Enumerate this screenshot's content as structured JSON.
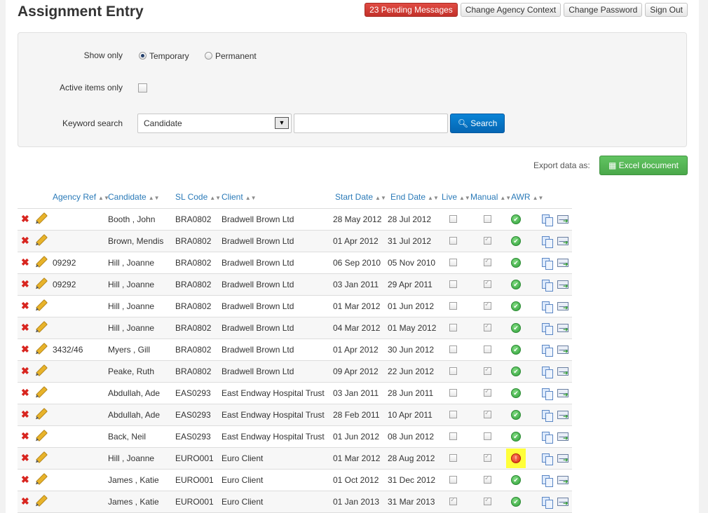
{
  "page": {
    "title": "Assignment Entry"
  },
  "topbar": {
    "pending": "23 Pending Messages",
    "change_agency": "Change Agency Context",
    "change_password": "Change Password",
    "sign_out": "Sign Out"
  },
  "filters": {
    "show_only_label": "Show only",
    "option_temporary": "Temporary",
    "option_permanent": "Permanent",
    "selected": "Temporary",
    "active_only_label": "Active items only",
    "active_only_checked": false,
    "keyword_label": "Keyword search",
    "keyword_field": "Candidate",
    "keyword_value": "",
    "search_label": "Search"
  },
  "export": {
    "label": "Export data as:",
    "excel_label": "Excel document"
  },
  "table": {
    "columns": [
      "Agency Ref",
      "Candidate",
      "SL Code",
      "Client",
      "Start Date",
      "End Date",
      "Live",
      "Manual",
      "AWR"
    ],
    "rows": [
      {
        "ref": "",
        "candidate": "Booth , John",
        "sl": "BRA0802",
        "client": "Bradwell Brown Ltd",
        "start": "28 May 2012",
        "end": "28 Jul 2012",
        "live": false,
        "manual": false,
        "awr": "ok"
      },
      {
        "ref": "",
        "candidate": "Brown, Mendis",
        "sl": "BRA0802",
        "client": "Bradwell Brown Ltd",
        "start": "01 Apr 2012",
        "end": "31 Jul 2012",
        "live": false,
        "manual": true,
        "awr": "ok"
      },
      {
        "ref": "09292",
        "candidate": "Hill , Joanne",
        "sl": "BRA0802",
        "client": "Bradwell Brown Ltd",
        "start": "06 Sep 2010",
        "end": "05 Nov 2010",
        "live": false,
        "manual": true,
        "awr": "ok"
      },
      {
        "ref": "09292",
        "candidate": "Hill , Joanne",
        "sl": "BRA0802",
        "client": "Bradwell Brown Ltd",
        "start": "03 Jan 2011",
        "end": "29 Apr 2011",
        "live": false,
        "manual": true,
        "awr": "ok"
      },
      {
        "ref": "",
        "candidate": "Hill , Joanne",
        "sl": "BRA0802",
        "client": "Bradwell Brown Ltd",
        "start": "01 Mar 2012",
        "end": "01 Jun 2012",
        "live": false,
        "manual": true,
        "awr": "ok"
      },
      {
        "ref": "",
        "candidate": "Hill , Joanne",
        "sl": "BRA0802",
        "client": "Bradwell Brown Ltd",
        "start": "04 Mar 2012",
        "end": "01 May 2012",
        "live": false,
        "manual": true,
        "awr": "ok"
      },
      {
        "ref": "3432/46",
        "candidate": "Myers , Gill",
        "sl": "BRA0802",
        "client": "Bradwell Brown Ltd",
        "start": "01 Apr 2012",
        "end": "30 Jun 2012",
        "live": false,
        "manual": false,
        "awr": "ok"
      },
      {
        "ref": "",
        "candidate": "Peake, Ruth",
        "sl": "BRA0802",
        "client": "Bradwell Brown Ltd",
        "start": "09 Apr 2012",
        "end": "22 Jun 2012",
        "live": false,
        "manual": true,
        "awr": "ok"
      },
      {
        "ref": "",
        "candidate": "Abdullah, Ade",
        "sl": "EAS0293",
        "client": "East Endway Hospital Trust",
        "start": "03 Jan 2011",
        "end": "28 Jun 2011",
        "live": false,
        "manual": true,
        "awr": "ok"
      },
      {
        "ref": "",
        "candidate": "Abdullah, Ade",
        "sl": "EAS0293",
        "client": "East Endway Hospital Trust",
        "start": "28 Feb 2011",
        "end": "10 Apr 2011",
        "live": false,
        "manual": true,
        "awr": "ok"
      },
      {
        "ref": "",
        "candidate": "Back, Neil",
        "sl": "EAS0293",
        "client": "East Endway Hospital Trust",
        "start": "01 Jun 2012",
        "end": "08 Jun 2012",
        "live": false,
        "manual": false,
        "awr": "ok"
      },
      {
        "ref": "",
        "candidate": "Hill , Joanne",
        "sl": "EURO001",
        "client": "Euro Client",
        "start": "01 Mar 2012",
        "end": "28 Aug 2012",
        "live": false,
        "manual": true,
        "awr": "warn"
      },
      {
        "ref": "",
        "candidate": "James , Katie",
        "sl": "EURO001",
        "client": "Euro Client",
        "start": "01 Oct 2012",
        "end": "31 Dec 2012",
        "live": false,
        "manual": true,
        "awr": "ok"
      },
      {
        "ref": "",
        "candidate": "James , Katie",
        "sl": "EURO001",
        "client": "Euro Client",
        "start": "01 Jan 2013",
        "end": "31 Mar 2013",
        "live": true,
        "manual": true,
        "awr": "ok"
      }
    ]
  },
  "colors": {
    "accent": "#0566b3",
    "link": "#2a7ab8",
    "danger": "#c3312a",
    "success": "#4aa84a",
    "highlight": "#ffff3a"
  }
}
